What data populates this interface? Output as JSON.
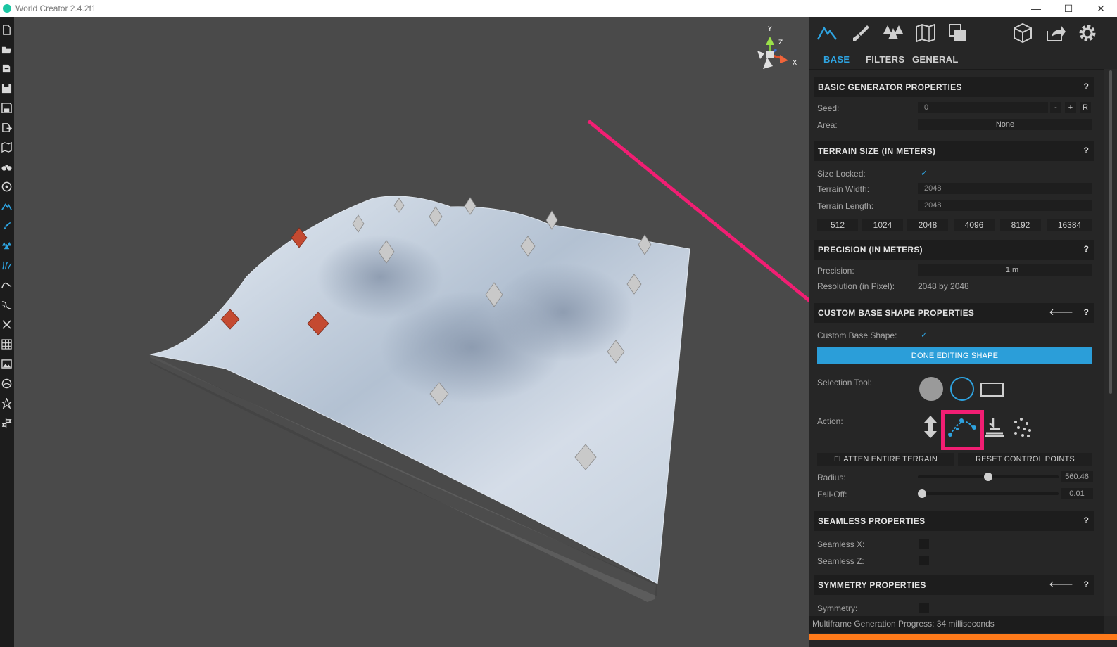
{
  "window": {
    "title": "World Creator 2.4.2f1",
    "min": "—",
    "max": "☐",
    "close": "✕"
  },
  "left_toolbar": {
    "icons": [
      "new-file-icon",
      "open-folder-icon",
      "open-recent-icon",
      "save-icon",
      "save-as-icon",
      "export-icon",
      "map-icon",
      "binoculars-icon",
      "steering-icon",
      "mountain-icon",
      "paint-brush-icon",
      "trees-icon",
      "grass-icon",
      "wave-icon",
      "river-icon",
      "network-icon",
      "grid-icon",
      "image-icon",
      "globe-icon",
      "star-icon",
      "sign-icon"
    ]
  },
  "viewport": {
    "gizmo": {
      "y": "Y",
      "z": "Z",
      "x": "X"
    }
  },
  "panel": {
    "tabs": [
      {
        "label": "BASE",
        "active": true
      },
      {
        "label": "FILTERS"
      },
      {
        "label": "GENERAL"
      }
    ],
    "top_icons": [
      "terrain-icon",
      "brush-icon",
      "forest-icon",
      "map-icon",
      "layers-icon",
      "cube-icon",
      "export-icon",
      "settings-icon"
    ],
    "basic": {
      "title": "BASIC GENERATOR PROPERTIES",
      "help": "?",
      "seed_label": "Seed:",
      "seed_value": "0",
      "seed_minus": "-",
      "seed_plus": "+",
      "seed_r": "R",
      "area_label": "Area:",
      "area_value": "None"
    },
    "terrain_size": {
      "title": "TERRAIN SIZE (IN METERS)",
      "help": "?",
      "size_locked_label": "Size Locked:",
      "check": "✓",
      "width_label": "Terrain Width:",
      "width_value": "2048",
      "length_label": "Terrain Length:",
      "length_value": "2048",
      "presets": [
        "512",
        "1024",
        "2048",
        "4096",
        "8192",
        "16384"
      ]
    },
    "precision": {
      "title": "PRECISION (IN METERS)",
      "help": "?",
      "precision_label": "Precision:",
      "precision_value": "1 m",
      "resolution_label": "Resolution (in Pixel):",
      "resolution_value": "2048 by 2048"
    },
    "custom_shape": {
      "title": "CUSTOM BASE SHAPE PROPERTIES",
      "help": "?",
      "back": "🡐",
      "custom_label": "Custom Base Shape:",
      "check": "✓",
      "done_button": "DONE EDITING SHAPE",
      "selection_label": "Selection Tool:",
      "action_label": "Action:",
      "flatten_button": "FLATTEN ENTIRE TERRAIN",
      "reset_button": "RESET CONTROL POINTS",
      "radius_label": "Radius:",
      "radius_value": "560.46",
      "radius_fraction": 0.5,
      "falloff_label": "Fall-Off:",
      "falloff_value": "0.01",
      "falloff_fraction": 0.01
    },
    "seamless": {
      "title": "SEAMLESS PROPERTIES",
      "help": "?",
      "x_label": "Seamless X:",
      "z_label": "Seamless Z:"
    },
    "symmetry": {
      "title": "SYMMETRY PROPERTIES",
      "help": "?",
      "back": "🡐",
      "symmetry_label": "Symmetry:"
    },
    "status": "Multiframe Generation Progress: 34 milliseconds"
  },
  "colors": {
    "accent": "#2ea3e0",
    "highlight": "#f11e73",
    "progress": "#ff7a1a"
  }
}
